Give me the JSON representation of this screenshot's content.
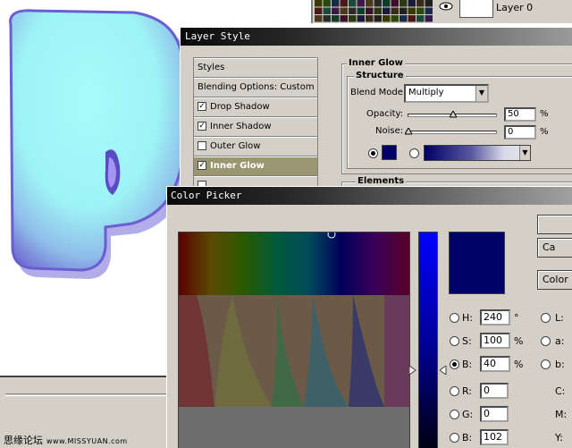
{
  "colors": {
    "selected_color": "#000066",
    "accent_selected_row": "#9b9670",
    "title_bar": "#0a0a0a"
  },
  "layers_palette": {
    "layer_name": "Layer 0",
    "visibility_icon": "eye-icon"
  },
  "layer_style": {
    "title": "Layer Style",
    "styles": [
      {
        "label": "Styles",
        "checkbox": false,
        "checked": false
      },
      {
        "label": "Blending Options: Custom",
        "checkbox": false,
        "checked": false
      },
      {
        "label": "Drop Shadow",
        "checkbox": true,
        "checked": true
      },
      {
        "label": "Inner Shadow",
        "checkbox": true,
        "checked": true
      },
      {
        "label": "Outer Glow",
        "checkbox": true,
        "checked": false
      },
      {
        "label": "Inner Glow",
        "checkbox": true,
        "checked": true,
        "selected": true
      }
    ],
    "panel": {
      "title": "Inner Glow",
      "structure_label": "Structure",
      "blend_mode_label": "Blend Mode:",
      "blend_mode_value": "Multiply",
      "opacity_label": "Opacity:",
      "opacity_value": "50",
      "opacity_unit": "%",
      "opacity_level": 0.5,
      "noise_label": "Noise:",
      "noise_value": "0",
      "noise_unit": "%",
      "noise_level": 0,
      "elements_label": "Elements"
    }
  },
  "color_picker": {
    "title": "Color Picker",
    "buttons": [
      "",
      "Ca",
      "Color"
    ],
    "hsb": [
      {
        "label": "H:",
        "value": "240",
        "unit": "°",
        "selected": false
      },
      {
        "label": "S:",
        "value": "100",
        "unit": "%",
        "selected": false
      },
      {
        "label": "B:",
        "value": "40",
        "unit": "%",
        "selected": true
      }
    ],
    "rgb": [
      {
        "label": "R:",
        "value": "0",
        "selected": false
      },
      {
        "label": "G:",
        "value": "0",
        "selected": false
      },
      {
        "label": "B:",
        "value": "102",
        "selected": false
      }
    ],
    "lab": [
      "L:",
      "a:",
      "b:"
    ],
    "cmyk": [
      "C:",
      "M:",
      "Y:"
    ]
  },
  "watermark": {
    "text": "思缘论坛",
    "url": "www.MISSYUAN.com"
  }
}
